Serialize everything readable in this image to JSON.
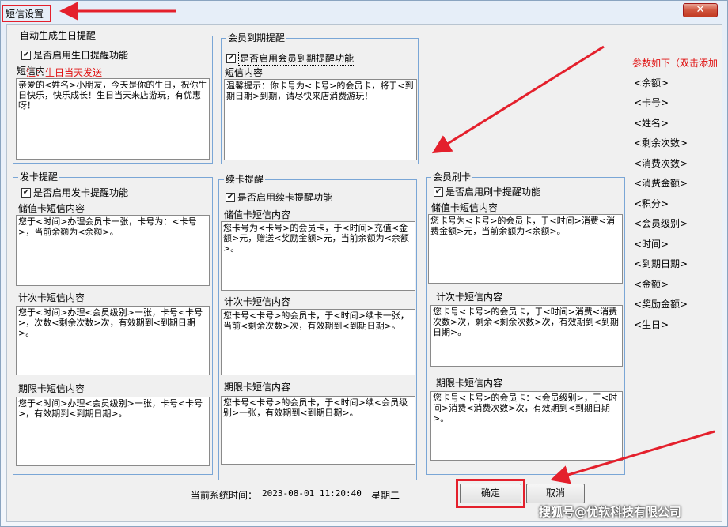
{
  "window": {
    "title": "短信设置",
    "close_glyph": "✕"
  },
  "birthday": {
    "group_title": "自动生成生日提醒",
    "enable_label": "是否启用生日提醒功能",
    "partial_label": "短信内",
    "note": "注：生日当天发送",
    "content": "亲爱的<姓名>小朋友，今天是你的生日，祝你生日快乐，快乐成长！生日当天来店游玩，有优惠呀！"
  },
  "expiry": {
    "group_title": "会员到期提醒",
    "enable_label": "是否启用会员到期提醒功能",
    "content_label": "短信内容",
    "content": "温馨提示：你卡号为<卡号>的会员卡，将于<到期日期>到期，请尽快来店消费游玩！"
  },
  "issue": {
    "group_title": "发卡提醒",
    "enable_label": "是否启用发卡提醒功能",
    "stored_label": "储值卡短信内容",
    "stored_content": "您于<时间>办理会员卡一张，卡号为：<卡号>，当前余额为<余额>。",
    "count_label": "计次卡短信内容",
    "count_content": "您于<时间>办理<会员级别>一张，卡号<卡号>，次数<剩余次数>次，有效期到<到期日期>。",
    "period_label": "期限卡短信内容",
    "period_content": "您于<时间>办理<会员级别>一张，卡号<卡号>，有效期到<到期日期>。"
  },
  "renew": {
    "group_title": "续卡提醒",
    "enable_label": "是否启用续卡提醒功能",
    "stored_label": "储值卡短信内容",
    "stored_content": "您卡号为<卡号>的会员卡，于<时间>充值<金额>元，赠送<奖励金额>元，当前余额为<余额>。",
    "count_label": "计次卡短信内容",
    "count_content": "您卡号<卡号>的会员卡，于<时间>续卡一张，当前<剩余次数>次，有效期到<到期日期>。",
    "period_label": "期限卡短信内容",
    "period_content": "您卡号<卡号>的会员卡，于<时间>续<会员级别>一张，有效期到<到期日期>。"
  },
  "swipe": {
    "group_title": "会员刷卡",
    "enable_label": "是否启用刷卡提醒功能",
    "stored_label": "储值卡短信内容",
    "stored_content": "您卡号为<卡号>的会员卡，于<时间>消费<消费金额>元，当前余额为<余额>。",
    "count_label": "计次卡短信内容",
    "count_content": "您卡号<卡号>的会员卡，于<时间>消费<消费次数>次，剩余<剩余次数>次，有效期到<到期日期>。",
    "period_label": "期限卡短信内容",
    "period_content": "您卡号<卡号>的会员卡：<会员级别>，于<时间>消费<消费次数>次，有效期到<到期日期>。"
  },
  "params": {
    "title": "参数如下（双击添加",
    "items": [
      "<余额>",
      "<卡号>",
      "<姓名>",
      "<剩余次数>",
      "<消费次数>",
      "<消费金额>",
      "<积分>",
      "<会员级别>",
      "<时间>",
      "<到期日期>",
      "<金额>",
      "<奖励金额>",
      "<生日>"
    ]
  },
  "status": {
    "time_label": "当前系统时间：",
    "datetime": "2023-08-01 11:20:40",
    "weekday": "星期二"
  },
  "buttons": {
    "ok": "确定",
    "cancel": "取消"
  },
  "watermark": "搜狐号@优软科技有限公司",
  "colors": {
    "annotation_red": "#e4202c",
    "group_border": "#7aa6d6",
    "note_red": "#e01010"
  }
}
